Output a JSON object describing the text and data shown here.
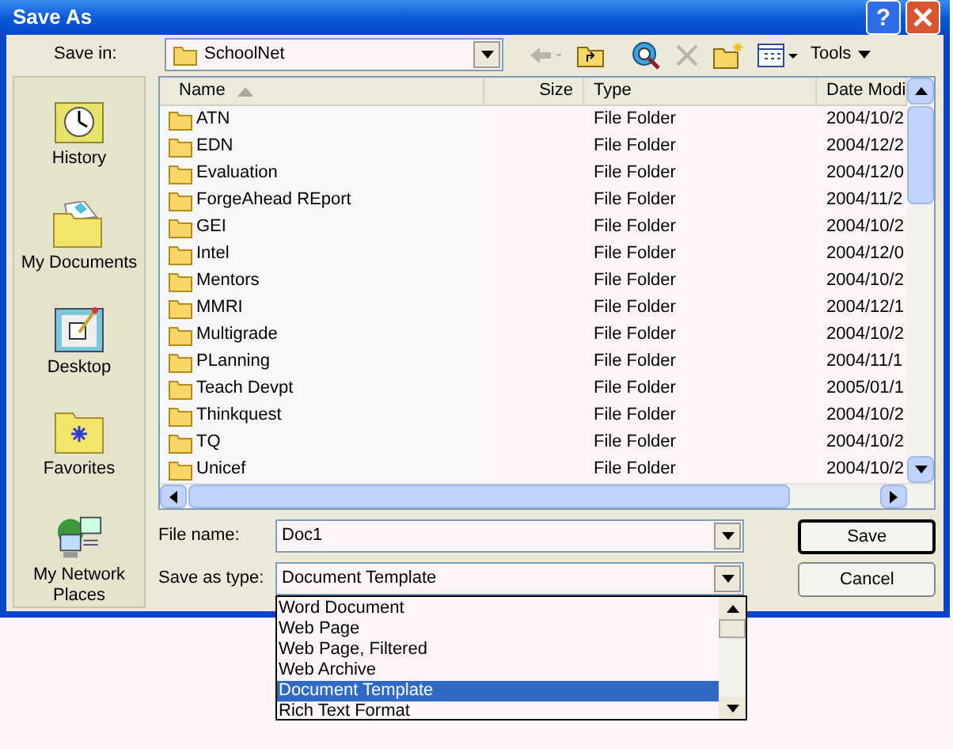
{
  "window": {
    "title": "Save As",
    "help": "?"
  },
  "save_in": {
    "label": "Save in:",
    "value": "SchoolNet"
  },
  "toolbar": {
    "tools": "Tools"
  },
  "places": [
    {
      "kind": "history",
      "label": "History"
    },
    {
      "kind": "documents",
      "label": "My Documents"
    },
    {
      "kind": "desktop",
      "label": "Desktop"
    },
    {
      "kind": "favorites",
      "label": "Favorites"
    },
    {
      "kind": "network",
      "label": "My Network Places"
    }
  ],
  "file_list": {
    "columns": [
      "Name",
      "Size",
      "Type",
      "Date Modi"
    ],
    "rows": [
      {
        "name": "ATN",
        "type": "File Folder",
        "date": "2004/10/2"
      },
      {
        "name": "EDN",
        "type": "File Folder",
        "date": "2004/12/2"
      },
      {
        "name": "Evaluation",
        "type": "File Folder",
        "date": "2004/12/0"
      },
      {
        "name": "ForgeAhead REport",
        "type": "File Folder",
        "date": "2004/11/2"
      },
      {
        "name": "GEI",
        "type": "File Folder",
        "date": "2004/10/2"
      },
      {
        "name": "Intel",
        "type": "File Folder",
        "date": "2004/12/0"
      },
      {
        "name": "Mentors",
        "type": "File Folder",
        "date": "2004/10/2"
      },
      {
        "name": "MMRI",
        "type": "File Folder",
        "date": "2004/12/1"
      },
      {
        "name": "Multigrade",
        "type": "File Folder",
        "date": "2004/10/2"
      },
      {
        "name": "PLanning",
        "type": "File Folder",
        "date": "2004/11/1"
      },
      {
        "name": "Teach Devpt",
        "type": "File Folder",
        "date": "2005/01/1"
      },
      {
        "name": "Thinkquest",
        "type": "File Folder",
        "date": "2004/10/2"
      },
      {
        "name": "TQ",
        "type": "File Folder",
        "date": "2004/10/2"
      },
      {
        "name": "Unicef",
        "type": "File Folder",
        "date": "2004/10/2"
      }
    ]
  },
  "file_name": {
    "label": "File name:",
    "value": "Doc1"
  },
  "save_as_type": {
    "label": "Save as type:",
    "value": "Document Template",
    "options": [
      {
        "label": "Word Document",
        "selected": false
      },
      {
        "label": "Web Page",
        "selected": false
      },
      {
        "label": "Web Page, Filtered",
        "selected": false
      },
      {
        "label": "Web Archive",
        "selected": false
      },
      {
        "label": "Document Template",
        "selected": true
      },
      {
        "label": "Rich Text Format",
        "selected": false
      }
    ]
  },
  "buttons": [
    "Save",
    "Cancel"
  ]
}
